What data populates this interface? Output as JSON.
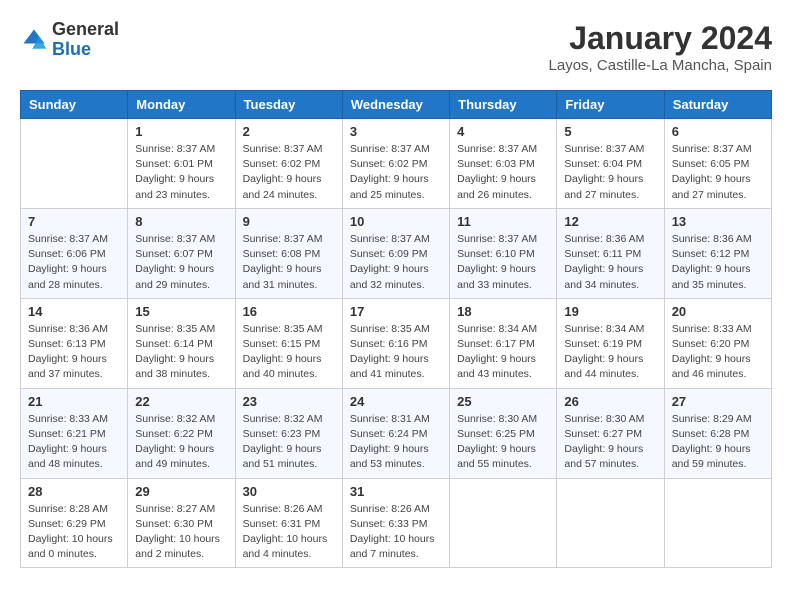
{
  "logo": {
    "general": "General",
    "blue": "Blue"
  },
  "header": {
    "month_year": "January 2024",
    "location": "Layos, Castille-La Mancha, Spain"
  },
  "weekdays": [
    "Sunday",
    "Monday",
    "Tuesday",
    "Wednesday",
    "Thursday",
    "Friday",
    "Saturday"
  ],
  "weeks": [
    [
      {
        "day": "",
        "sunrise": "",
        "sunset": "",
        "daylight": ""
      },
      {
        "day": "1",
        "sunrise": "Sunrise: 8:37 AM",
        "sunset": "Sunset: 6:01 PM",
        "daylight": "Daylight: 9 hours and 23 minutes."
      },
      {
        "day": "2",
        "sunrise": "Sunrise: 8:37 AM",
        "sunset": "Sunset: 6:02 PM",
        "daylight": "Daylight: 9 hours and 24 minutes."
      },
      {
        "day": "3",
        "sunrise": "Sunrise: 8:37 AM",
        "sunset": "Sunset: 6:02 PM",
        "daylight": "Daylight: 9 hours and 25 minutes."
      },
      {
        "day": "4",
        "sunrise": "Sunrise: 8:37 AM",
        "sunset": "Sunset: 6:03 PM",
        "daylight": "Daylight: 9 hours and 26 minutes."
      },
      {
        "day": "5",
        "sunrise": "Sunrise: 8:37 AM",
        "sunset": "Sunset: 6:04 PM",
        "daylight": "Daylight: 9 hours and 27 minutes."
      },
      {
        "day": "6",
        "sunrise": "Sunrise: 8:37 AM",
        "sunset": "Sunset: 6:05 PM",
        "daylight": "Daylight: 9 hours and 27 minutes."
      }
    ],
    [
      {
        "day": "7",
        "sunrise": "Sunrise: 8:37 AM",
        "sunset": "Sunset: 6:06 PM",
        "daylight": "Daylight: 9 hours and 28 minutes."
      },
      {
        "day": "8",
        "sunrise": "Sunrise: 8:37 AM",
        "sunset": "Sunset: 6:07 PM",
        "daylight": "Daylight: 9 hours and 29 minutes."
      },
      {
        "day": "9",
        "sunrise": "Sunrise: 8:37 AM",
        "sunset": "Sunset: 6:08 PM",
        "daylight": "Daylight: 9 hours and 31 minutes."
      },
      {
        "day": "10",
        "sunrise": "Sunrise: 8:37 AM",
        "sunset": "Sunset: 6:09 PM",
        "daylight": "Daylight: 9 hours and 32 minutes."
      },
      {
        "day": "11",
        "sunrise": "Sunrise: 8:37 AM",
        "sunset": "Sunset: 6:10 PM",
        "daylight": "Daylight: 9 hours and 33 minutes."
      },
      {
        "day": "12",
        "sunrise": "Sunrise: 8:36 AM",
        "sunset": "Sunset: 6:11 PM",
        "daylight": "Daylight: 9 hours and 34 minutes."
      },
      {
        "day": "13",
        "sunrise": "Sunrise: 8:36 AM",
        "sunset": "Sunset: 6:12 PM",
        "daylight": "Daylight: 9 hours and 35 minutes."
      }
    ],
    [
      {
        "day": "14",
        "sunrise": "Sunrise: 8:36 AM",
        "sunset": "Sunset: 6:13 PM",
        "daylight": "Daylight: 9 hours and 37 minutes."
      },
      {
        "day": "15",
        "sunrise": "Sunrise: 8:35 AM",
        "sunset": "Sunset: 6:14 PM",
        "daylight": "Daylight: 9 hours and 38 minutes."
      },
      {
        "day": "16",
        "sunrise": "Sunrise: 8:35 AM",
        "sunset": "Sunset: 6:15 PM",
        "daylight": "Daylight: 9 hours and 40 minutes."
      },
      {
        "day": "17",
        "sunrise": "Sunrise: 8:35 AM",
        "sunset": "Sunset: 6:16 PM",
        "daylight": "Daylight: 9 hours and 41 minutes."
      },
      {
        "day": "18",
        "sunrise": "Sunrise: 8:34 AM",
        "sunset": "Sunset: 6:17 PM",
        "daylight": "Daylight: 9 hours and 43 minutes."
      },
      {
        "day": "19",
        "sunrise": "Sunrise: 8:34 AM",
        "sunset": "Sunset: 6:19 PM",
        "daylight": "Daylight: 9 hours and 44 minutes."
      },
      {
        "day": "20",
        "sunrise": "Sunrise: 8:33 AM",
        "sunset": "Sunset: 6:20 PM",
        "daylight": "Daylight: 9 hours and 46 minutes."
      }
    ],
    [
      {
        "day": "21",
        "sunrise": "Sunrise: 8:33 AM",
        "sunset": "Sunset: 6:21 PM",
        "daylight": "Daylight: 9 hours and 48 minutes."
      },
      {
        "day": "22",
        "sunrise": "Sunrise: 8:32 AM",
        "sunset": "Sunset: 6:22 PM",
        "daylight": "Daylight: 9 hours and 49 minutes."
      },
      {
        "day": "23",
        "sunrise": "Sunrise: 8:32 AM",
        "sunset": "Sunset: 6:23 PM",
        "daylight": "Daylight: 9 hours and 51 minutes."
      },
      {
        "day": "24",
        "sunrise": "Sunrise: 8:31 AM",
        "sunset": "Sunset: 6:24 PM",
        "daylight": "Daylight: 9 hours and 53 minutes."
      },
      {
        "day": "25",
        "sunrise": "Sunrise: 8:30 AM",
        "sunset": "Sunset: 6:25 PM",
        "daylight": "Daylight: 9 hours and 55 minutes."
      },
      {
        "day": "26",
        "sunrise": "Sunrise: 8:30 AM",
        "sunset": "Sunset: 6:27 PM",
        "daylight": "Daylight: 9 hours and 57 minutes."
      },
      {
        "day": "27",
        "sunrise": "Sunrise: 8:29 AM",
        "sunset": "Sunset: 6:28 PM",
        "daylight": "Daylight: 9 hours and 59 minutes."
      }
    ],
    [
      {
        "day": "28",
        "sunrise": "Sunrise: 8:28 AM",
        "sunset": "Sunset: 6:29 PM",
        "daylight": "Daylight: 10 hours and 0 minutes."
      },
      {
        "day": "29",
        "sunrise": "Sunrise: 8:27 AM",
        "sunset": "Sunset: 6:30 PM",
        "daylight": "Daylight: 10 hours and 2 minutes."
      },
      {
        "day": "30",
        "sunrise": "Sunrise: 8:26 AM",
        "sunset": "Sunset: 6:31 PM",
        "daylight": "Daylight: 10 hours and 4 minutes."
      },
      {
        "day": "31",
        "sunrise": "Sunrise: 8:26 AM",
        "sunset": "Sunset: 6:33 PM",
        "daylight": "Daylight: 10 hours and 7 minutes."
      },
      {
        "day": "",
        "sunrise": "",
        "sunset": "",
        "daylight": ""
      },
      {
        "day": "",
        "sunrise": "",
        "sunset": "",
        "daylight": ""
      },
      {
        "day": "",
        "sunrise": "",
        "sunset": "",
        "daylight": ""
      }
    ]
  ]
}
